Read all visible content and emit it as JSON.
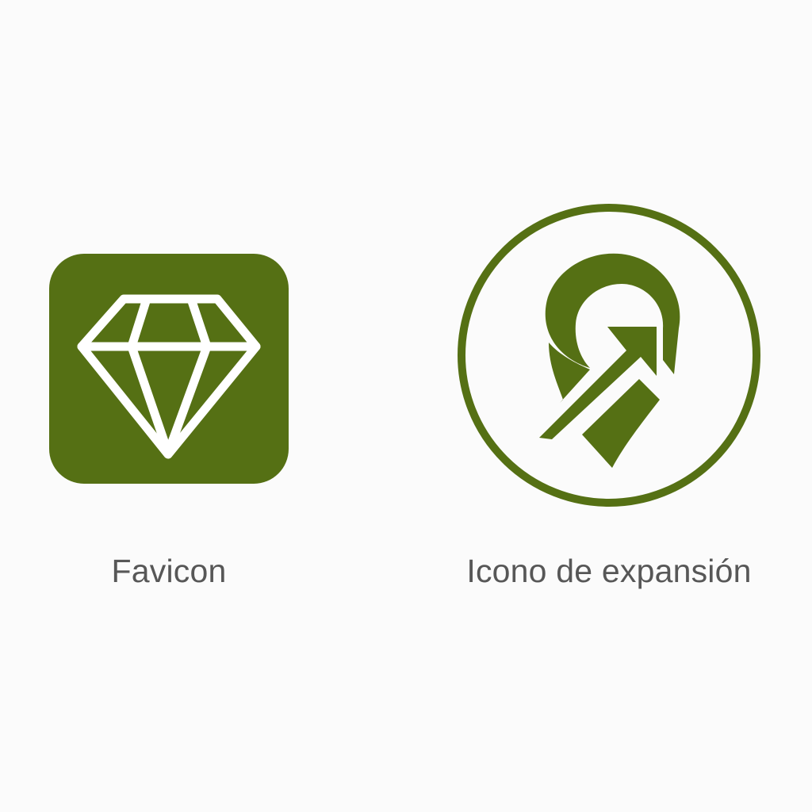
{
  "colors": {
    "background": "#fbfbfb",
    "brand_green": "#557014",
    "icon_white": "#ffffff",
    "caption_text": "#575757"
  },
  "icons": [
    {
      "id": "favicon",
      "icon": "diamond-icon",
      "shape": "rounded-square",
      "label": "Favicon"
    },
    {
      "id": "expansion",
      "icon": "location-pin-arrow-icon",
      "shape": "circle-outline",
      "label": "Icono de expansión"
    }
  ]
}
